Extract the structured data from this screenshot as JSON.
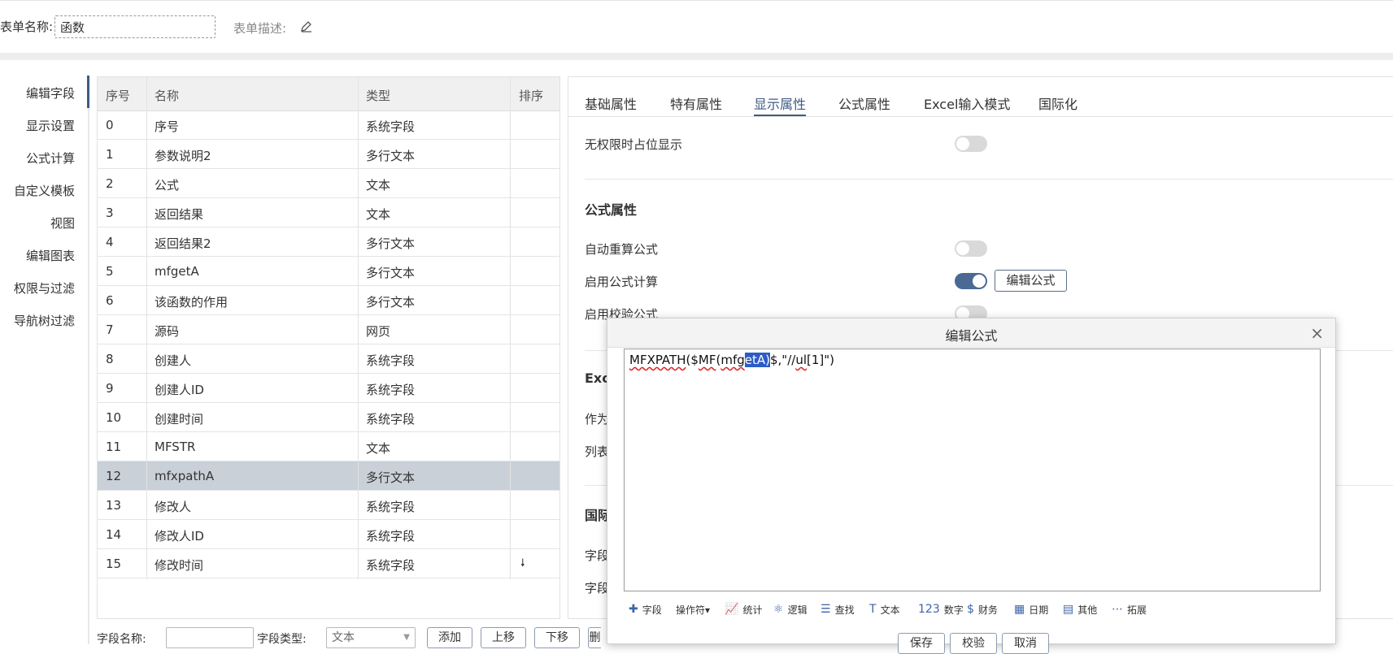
{
  "header": {
    "form_name_label": "表单名称:",
    "form_name_value": "函数",
    "form_desc_label": "表单描述:"
  },
  "nav": {
    "items": [
      "编辑字段",
      "显示设置",
      "公式计算",
      "自定义模板",
      "视图",
      "编辑图表",
      "权限与过滤",
      "导航树过滤"
    ],
    "active": "编辑字段"
  },
  "table": {
    "headers": [
      "序号",
      "名称",
      "类型",
      "排序"
    ],
    "rows": [
      {
        "idx": "0",
        "name": "序号",
        "type": "系统字段"
      },
      {
        "idx": "1",
        "name": "参数说明2",
        "type": "多行文本"
      },
      {
        "idx": "2",
        "name": "公式",
        "type": "文本"
      },
      {
        "idx": "3",
        "name": "返回结果",
        "type": "文本"
      },
      {
        "idx": "4",
        "name": "返回结果2",
        "type": "多行文本"
      },
      {
        "idx": "5",
        "name": "mfgetA",
        "type": "多行文本"
      },
      {
        "idx": "6",
        "name": "该函数的作用",
        "type": "多行文本"
      },
      {
        "idx": "7",
        "name": "源码",
        "type": "网页"
      },
      {
        "idx": "8",
        "name": "创建人",
        "type": "系统字段"
      },
      {
        "idx": "9",
        "name": "创建人ID",
        "type": "系统字段"
      },
      {
        "idx": "10",
        "name": "创建时间",
        "type": "系统字段"
      },
      {
        "idx": "11",
        "name": "MFSTR",
        "type": "文本"
      },
      {
        "idx": "12",
        "name": "mfxpathA",
        "type": "多行文本"
      },
      {
        "idx": "13",
        "name": "修改人",
        "type": "系统字段"
      },
      {
        "idx": "14",
        "name": "修改人ID",
        "type": "系统字段"
      },
      {
        "idx": "15",
        "name": "修改时间",
        "type": "系统字段"
      }
    ],
    "selected_index": 12,
    "sort_arrow": "🠗"
  },
  "bottom_toolbar": {
    "field_name_label": "字段名称:",
    "field_type_label": "字段类型:",
    "field_type_value": "文本",
    "add": "添加",
    "up": "上移",
    "down": "下移",
    "more": "删"
  },
  "props": {
    "tabs": [
      "基础属性",
      "特有属性",
      "显示属性",
      "公式属性",
      "Excel输入模式",
      "国际化"
    ],
    "active_tab": "显示属性",
    "no_perm_placeholder": "无权限时占位显示",
    "formula_section": "公式属性",
    "auto_recalc": "自动重算公式",
    "enable_formula": "启用公式计算",
    "edit_formula_btn": "编辑公式",
    "enable_validation": "启用校验公式",
    "excel_section_partial": "Exc",
    "row_as_partial": "作为",
    "row_list_partial": "列表",
    "intl_section_partial": "国际",
    "field_partial_1": "字段",
    "field_partial_2": "字段"
  },
  "modal": {
    "title": "编辑公式",
    "close": "×",
    "formula": {
      "p1": "MFXPATH",
      "p2": "($",
      "p3": "MF",
      "p4": "(",
      "p5": "mfg",
      "p6": "etA)",
      "p7": "$,\"//",
      "p8": "ul",
      "p9": "[1]\")"
    },
    "tools": [
      {
        "icon": "✚",
        "label": "字段"
      },
      {
        "icon": "",
        "label": "操作符▾"
      },
      {
        "icon": "📈",
        "label": "统计"
      },
      {
        "icon": "⚛",
        "label": "逻辑"
      },
      {
        "icon": "☰",
        "label": "查找"
      },
      {
        "icon": "T",
        "label": "文本"
      },
      {
        "icon": "123",
        "label": "数字"
      },
      {
        "icon": "$",
        "label": "财务"
      },
      {
        "icon": "▦",
        "label": "日期"
      },
      {
        "icon": "▤",
        "label": "其他"
      },
      {
        "icon": "⋯",
        "label": "拓展"
      }
    ],
    "buttons": [
      "保存",
      "校验",
      "取消"
    ]
  },
  "colors": {
    "accent": "#3d5b83",
    "selected_row": "#c9d0d8",
    "toggle_on": "#4a6a93",
    "toggle_off": "#d9d9d9"
  }
}
